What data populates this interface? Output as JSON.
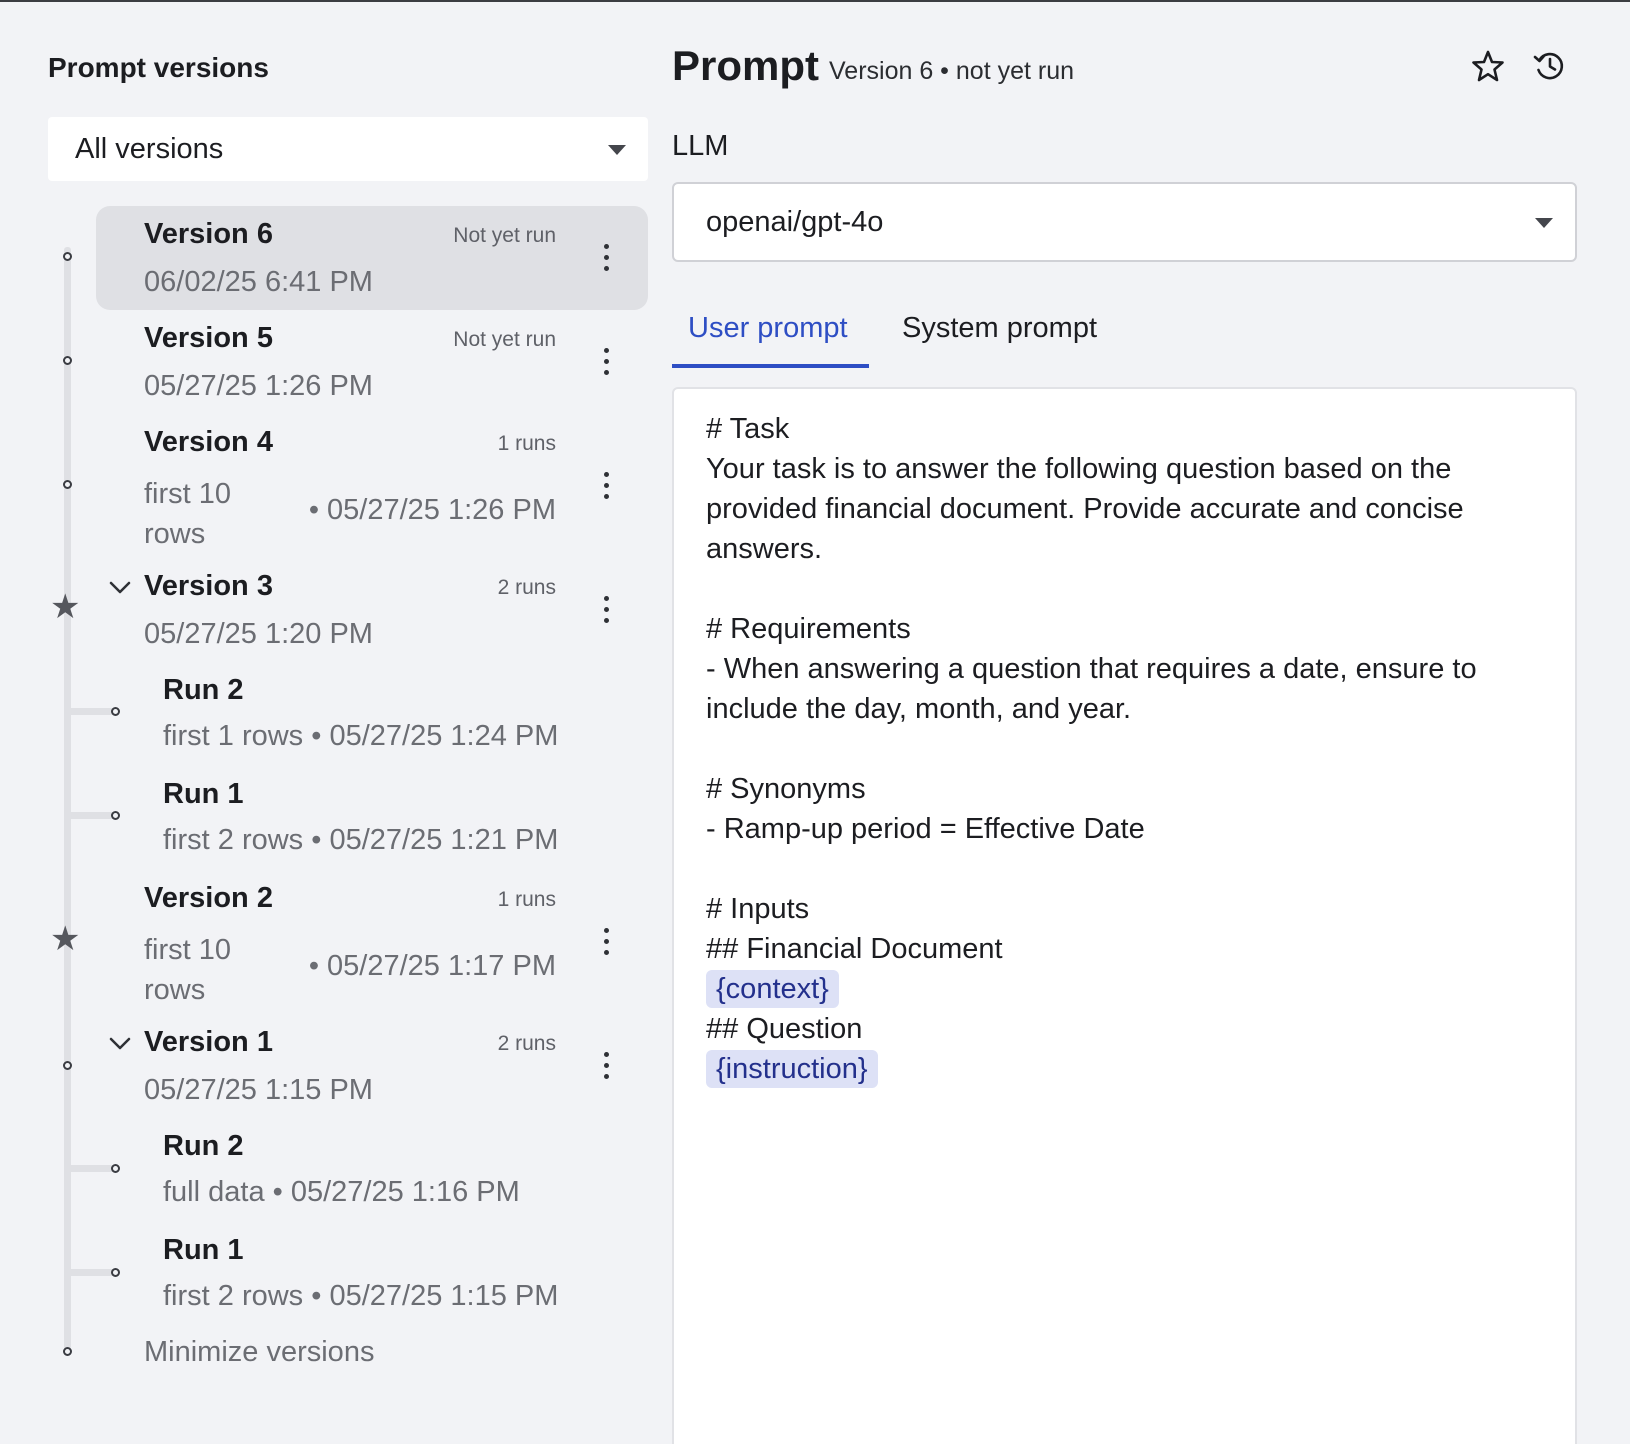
{
  "sidebar": {
    "title": "Prompt versions",
    "filter": {
      "selected": "All versions"
    },
    "versions": [
      {
        "title": "Version 6",
        "status": "Not yet run",
        "date": "06/02/25 6:41 PM",
        "selected": true
      },
      {
        "title": "Version 5",
        "status": "Not yet run",
        "date": "05/27/25 1:26 PM"
      },
      {
        "title": "Version 4",
        "status": "1 runs",
        "note": "first 10 rows",
        "date": "• 05/27/25 1:26 PM"
      },
      {
        "title": "Version 3",
        "status": "2 runs",
        "date": "05/27/25 1:20 PM",
        "starred": true,
        "expanded": true,
        "runs": [
          {
            "title": "Run 2",
            "meta": "first 1 rows • 05/27/25 1:24 PM"
          },
          {
            "title": "Run 1",
            "meta": "first 2 rows • 05/27/25 1:21 PM"
          }
        ]
      },
      {
        "title": "Version 2",
        "status": "1 runs",
        "note": "first 10 rows",
        "date": "• 05/27/25 1:17 PM",
        "starred": true
      },
      {
        "title": "Version 1",
        "status": "2 runs",
        "date": "05/27/25 1:15 PM",
        "expanded": true,
        "runs": [
          {
            "title": "Run 2",
            "meta": "full data • 05/27/25 1:16 PM"
          },
          {
            "title": "Run 1",
            "meta": "first 2 rows • 05/27/25 1:15 PM"
          }
        ]
      }
    ],
    "minimize_label": "Minimize versions"
  },
  "header": {
    "title": "Prompt",
    "meta": "Version 6 • not yet run",
    "icons": [
      "star-outline-icon",
      "history-icon"
    ]
  },
  "llm": {
    "label": "LLM",
    "selected": "openai/gpt-4o"
  },
  "tabs": [
    {
      "label": "User prompt",
      "active": true
    },
    {
      "label": "System prompt",
      "active": false
    }
  ],
  "editor": {
    "lines": [
      "# Task",
      "Your task is to answer the following question based on the",
      "provided financial document. Provide accurate and concise",
      "answers.",
      "",
      "# Requirements",
      "- When answering a question that requires a date, ensure to",
      "include the day, month, and year.",
      "",
      "# Synonyms",
      "- Ramp-up period = Effective Date",
      "",
      "# Inputs",
      "## Financial Document",
      {
        "variable": "{context}"
      },
      "## Question",
      {
        "variable": "{instruction}"
      }
    ]
  },
  "colors": {
    "accent": "#2e4ec4",
    "background": "#f2f3f6",
    "selected_row": "#dfe0e4",
    "variable_chip": "#dde1f6"
  }
}
